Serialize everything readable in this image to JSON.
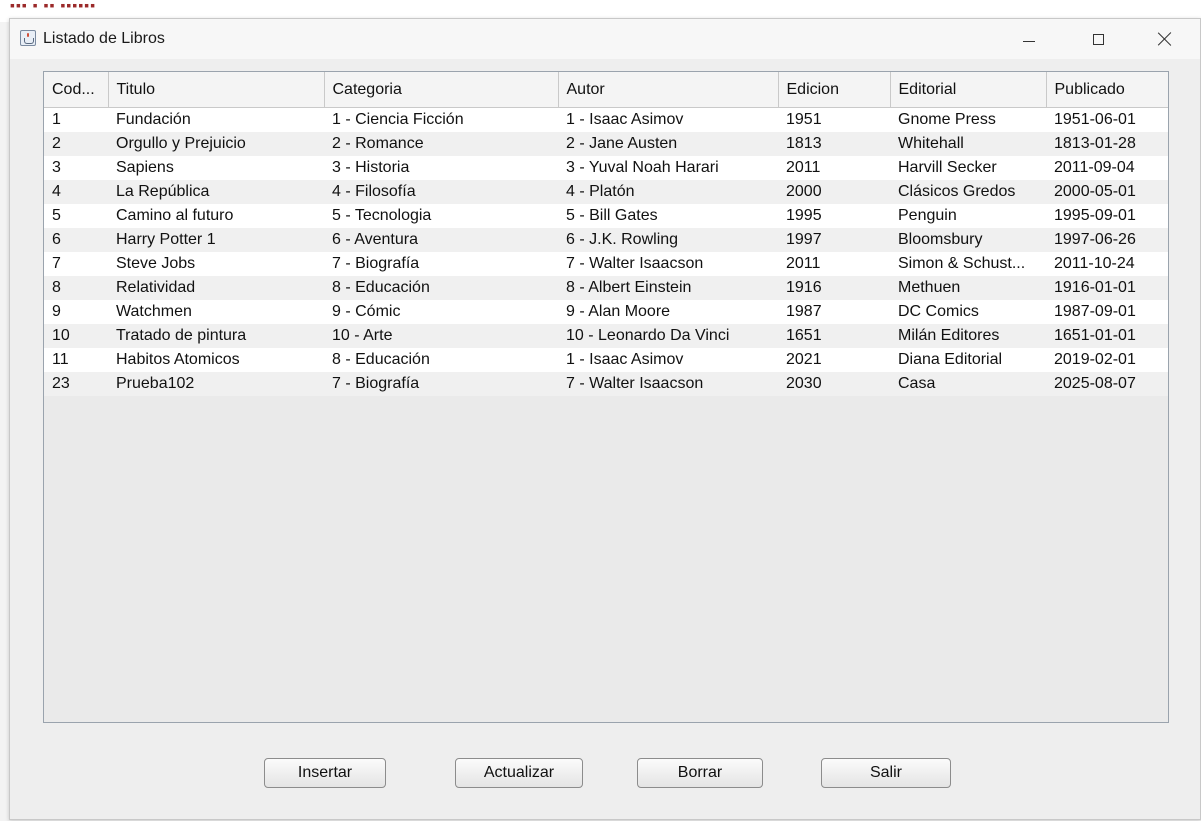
{
  "window": {
    "title": "Listado de Libros",
    "icon": "java-cup-icon"
  },
  "table": {
    "columns": [
      "Cod...",
      "Titulo",
      "Categoria",
      "Autor",
      "Edicion",
      "Editorial",
      "Publicado"
    ],
    "rows": [
      [
        "1",
        "Fundación",
        "1 - Ciencia Ficción",
        "1 - Isaac Asimov",
        "1951",
        "Gnome Press",
        "1951-06-01"
      ],
      [
        "2",
        "Orgullo y Prejuicio",
        "2 - Romance",
        "2 - Jane Austen",
        "1813",
        "Whitehall",
        "1813-01-28"
      ],
      [
        "3",
        "Sapiens",
        "3 - Historia",
        "3 - Yuval Noah Harari",
        "2011",
        "Harvill Secker",
        "2011-09-04"
      ],
      [
        "4",
        "La República",
        "4 - Filosofía",
        "4 - Platón",
        "2000",
        "Clásicos Gredos",
        "2000-05-01"
      ],
      [
        "5",
        "Camino al futuro",
        "5 - Tecnologia",
        "5 - Bill Gates",
        "1995",
        "Penguin",
        "1995-09-01"
      ],
      [
        "6",
        "Harry Potter 1",
        "6 - Aventura",
        "6 - J.K. Rowling",
        "1997",
        "Bloomsbury",
        "1997-06-26"
      ],
      [
        "7",
        "Steve Jobs",
        "7 - Biografía",
        "7 - Walter Isaacson",
        "2011",
        "Simon & Schust...",
        "2011-10-24"
      ],
      [
        "8",
        "Relatividad",
        "8 - Educación",
        "8 - Albert Einstein",
        "1916",
        "Methuen",
        "1916-01-01"
      ],
      [
        "9",
        "Watchmen",
        "9 - Cómic",
        "9 - Alan Moore",
        "1987",
        "DC Comics",
        "1987-09-01"
      ],
      [
        "10",
        "Tratado de pintura",
        "10 - Arte",
        "10 - Leonardo Da Vinci",
        "1651",
        "Milán Editores",
        "1651-01-01"
      ],
      [
        "11",
        "Habitos Atomicos",
        "8 - Educación",
        "1 - Isaac Asimov",
        "2021",
        "Diana Editorial",
        "2019-02-01"
      ],
      [
        "23",
        "Prueba102",
        "7 - Biografía",
        "7 - Walter Isaacson",
        "2030",
        "Casa",
        "2025-08-07"
      ]
    ]
  },
  "buttons": {
    "insertar": "Insertar",
    "actualizar": "Actualizar",
    "borrar": "Borrar",
    "salir": "Salir"
  }
}
